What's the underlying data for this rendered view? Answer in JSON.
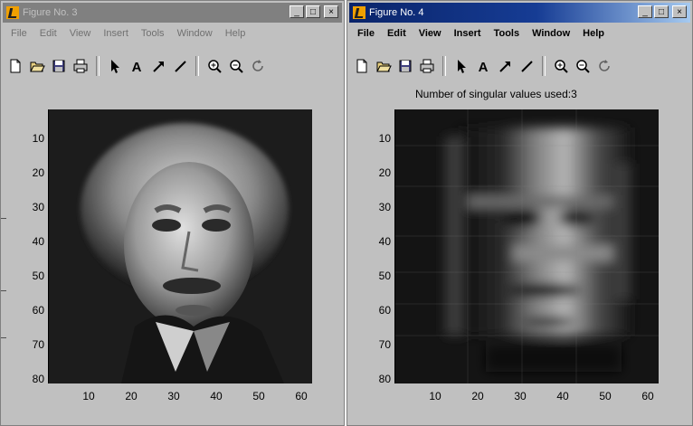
{
  "figures": [
    {
      "title": "Figure No. 3",
      "menu": [
        "File",
        "Edit",
        "View",
        "Insert",
        "Tools",
        "Window",
        "Help"
      ],
      "axes_title": "",
      "image": "portrait-original"
    },
    {
      "title": "Figure No. 4",
      "menu": [
        "File",
        "Edit",
        "View",
        "Insert",
        "Tools",
        "Window",
        "Help"
      ],
      "axes_title": "Number of singular values used:3",
      "image": "portrait-rank3-approximation"
    }
  ],
  "window_buttons": [
    "minimize",
    "maximize",
    "close"
  ],
  "toolbar_icons": [
    "new-file-icon",
    "open-folder-icon",
    "save-icon",
    "print-icon",
    "select-arrow-icon",
    "text-icon",
    "arrow-icon",
    "line-icon",
    "zoom-in-icon",
    "zoom-out-icon",
    "rotate-icon"
  ],
  "axes": {
    "yticks": [
      "10",
      "20",
      "30",
      "40",
      "50",
      "60",
      "70",
      "80"
    ],
    "xticks": [
      "10",
      "20",
      "30",
      "40",
      "50",
      "60"
    ],
    "xlim": [
      0,
      63
    ],
    "ylim": [
      0,
      80
    ]
  }
}
